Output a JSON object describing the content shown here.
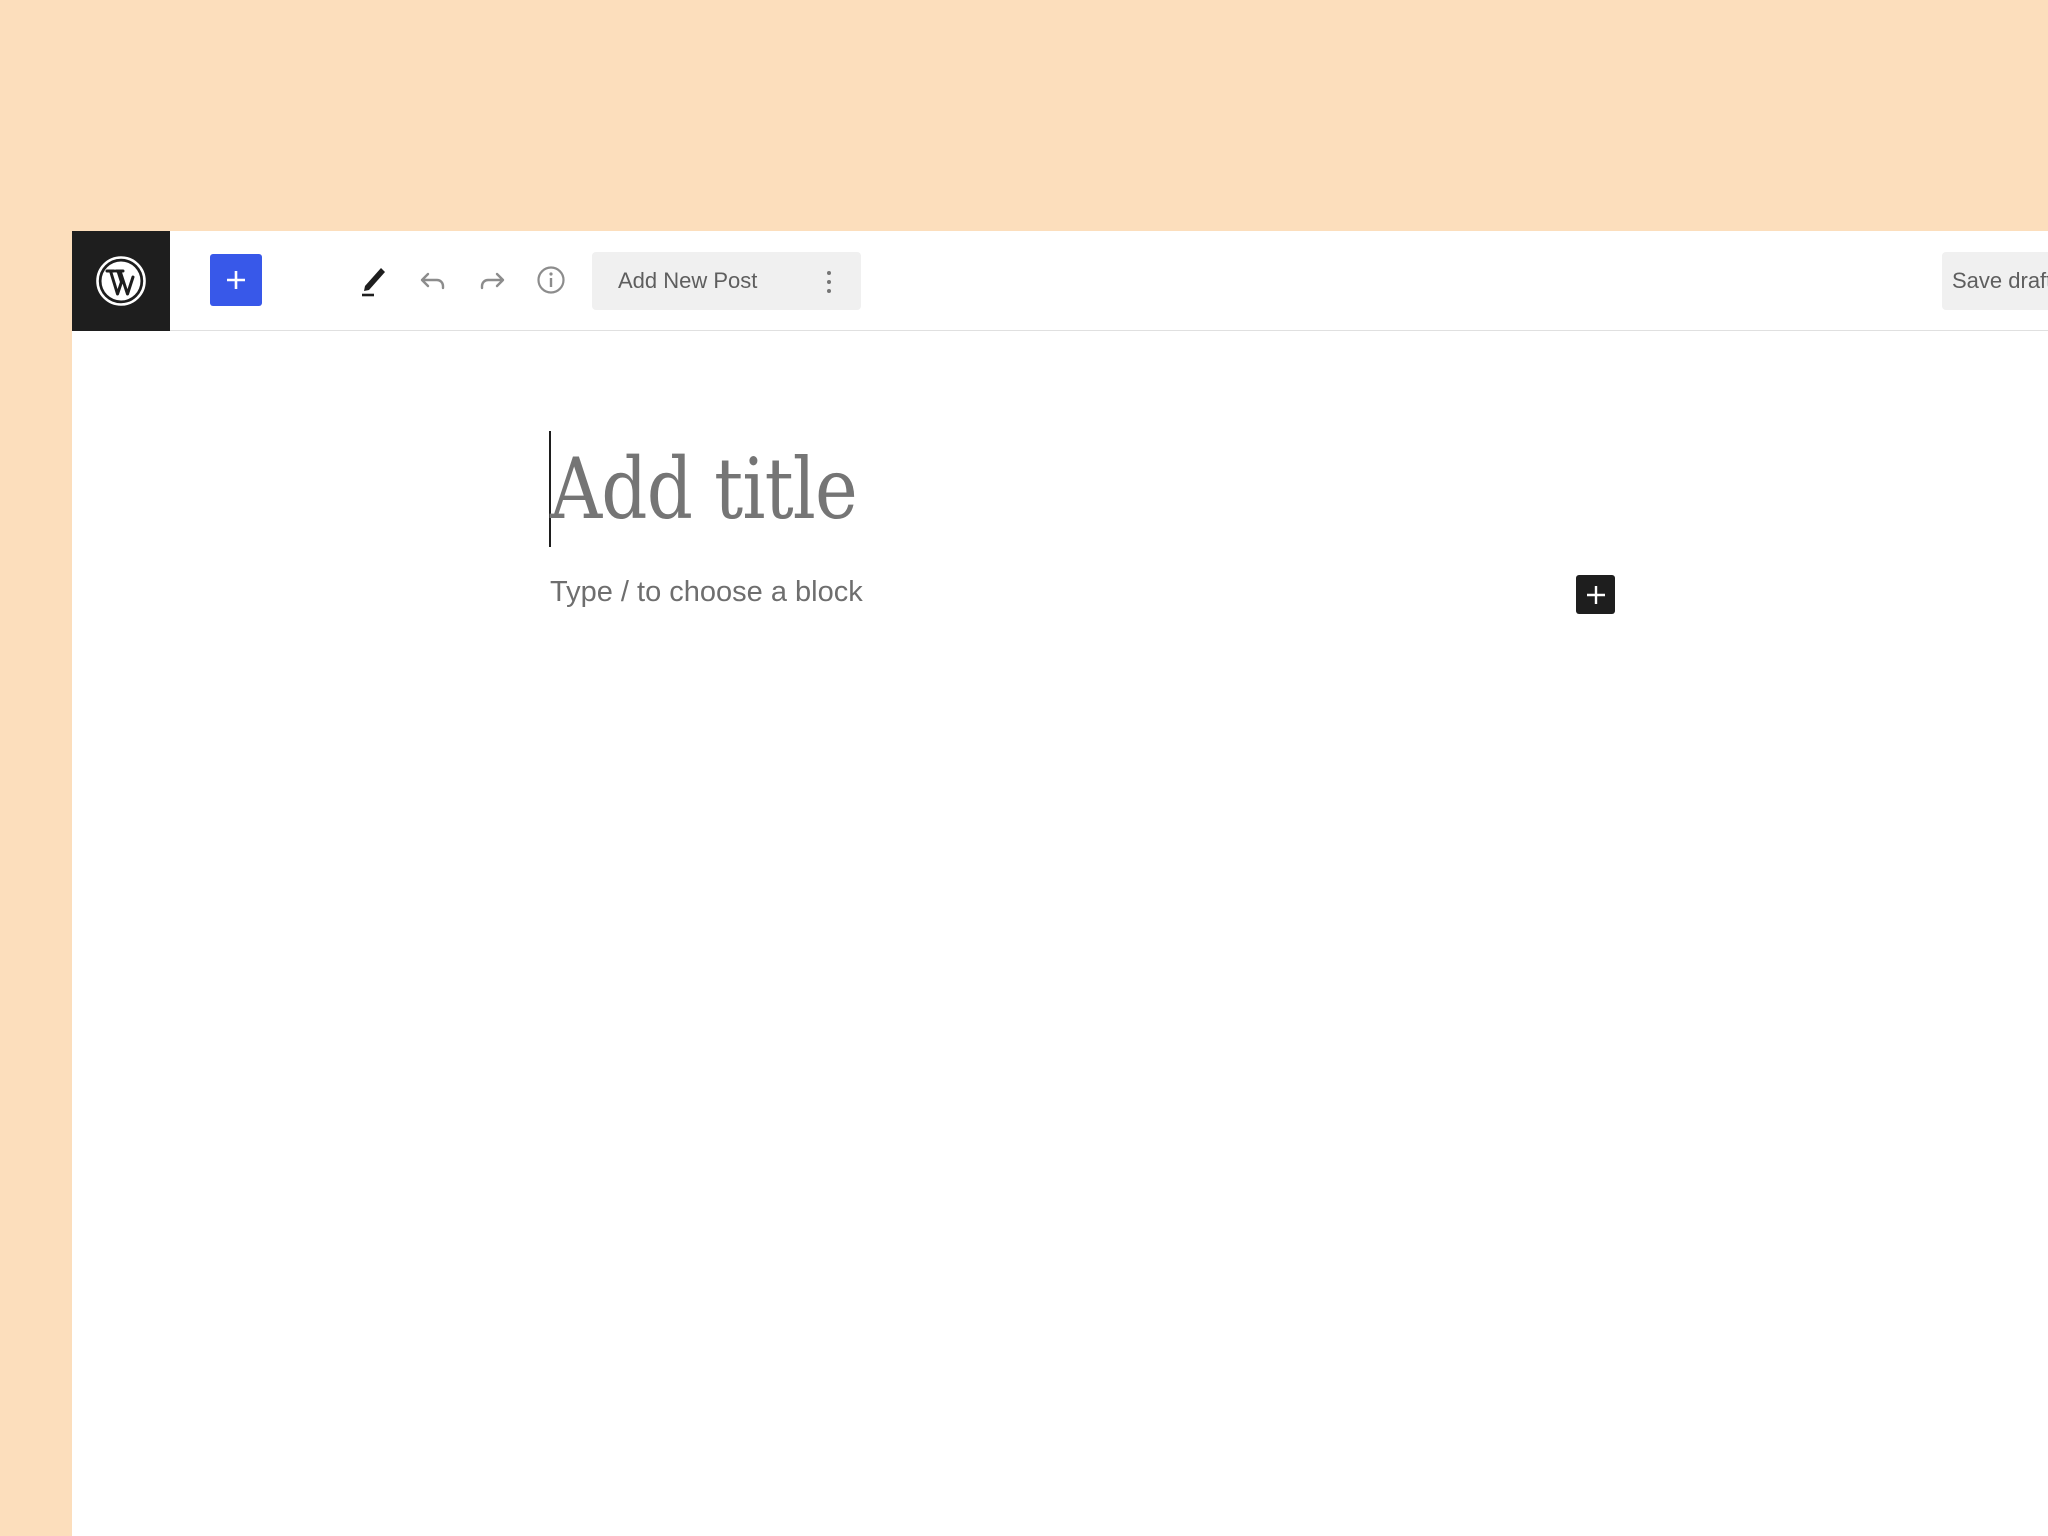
{
  "topbar": {
    "document_title": "Add New Post",
    "save_draft_label": "Save draft"
  },
  "editor": {
    "title_placeholder": "Add title",
    "block_placeholder": "Type / to choose a block"
  },
  "icons": {
    "logo": "wordpress-logo-icon",
    "add_block": "plus-icon",
    "tools": "pencil-icon",
    "undo": "undo-icon",
    "redo": "redo-icon",
    "details": "info-icon",
    "list_view": "list-view-icon",
    "options": "vertical-ellipsis-icon",
    "inline_add": "plus-icon"
  },
  "colors": {
    "backdrop": "#fcdebc",
    "accent": "#3858e9",
    "logo_bg": "#1e1e1e",
    "command_bar_bg": "#f0f0f0"
  }
}
